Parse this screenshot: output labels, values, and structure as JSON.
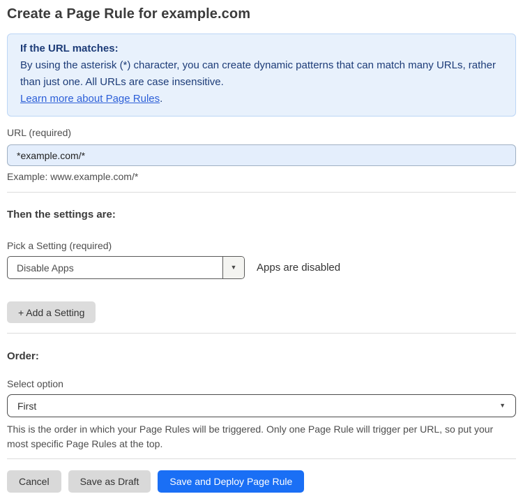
{
  "page": {
    "title": "Create a Page Rule for example.com"
  },
  "info_box": {
    "heading": "If the URL matches:",
    "body": "By using the asterisk (*) character, you can create dynamic patterns that can match many URLs, rather than just one. All URLs are case insensitive.",
    "link_label": "Learn more about Page Rules",
    "link_suffix": "."
  },
  "url_field": {
    "label": "URL (required)",
    "value": "*example.com/*",
    "helper": "Example: www.example.com/*"
  },
  "settings_section": {
    "heading": "Then the settings are:",
    "picker_label": "Pick a Setting (required)",
    "picker_value": "Disable Apps",
    "picker_status": "Apps are disabled",
    "add_setting_label": "+ Add a Setting"
  },
  "order_section": {
    "heading": "Order:",
    "select_label": "Select option",
    "select_value": "First",
    "helper": "This is the order in which your Page Rules will be triggered. Only one Page Rule will trigger per URL, so put your most specific Page Rules at the top."
  },
  "footer": {
    "cancel_label": "Cancel",
    "save_draft_label": "Save as Draft",
    "save_deploy_label": "Save and Deploy Page Rule"
  },
  "icons": {
    "dropdown_caret": "▼"
  },
  "colors": {
    "accent_blue": "#1a6ff5",
    "info_bg": "#e8f1fc",
    "info_border": "#bcd6f5",
    "info_text": "#1d3c78",
    "link_blue": "#2c5fd8",
    "input_bg": "#e4eefc",
    "button_gray": "#d9d9d9"
  }
}
